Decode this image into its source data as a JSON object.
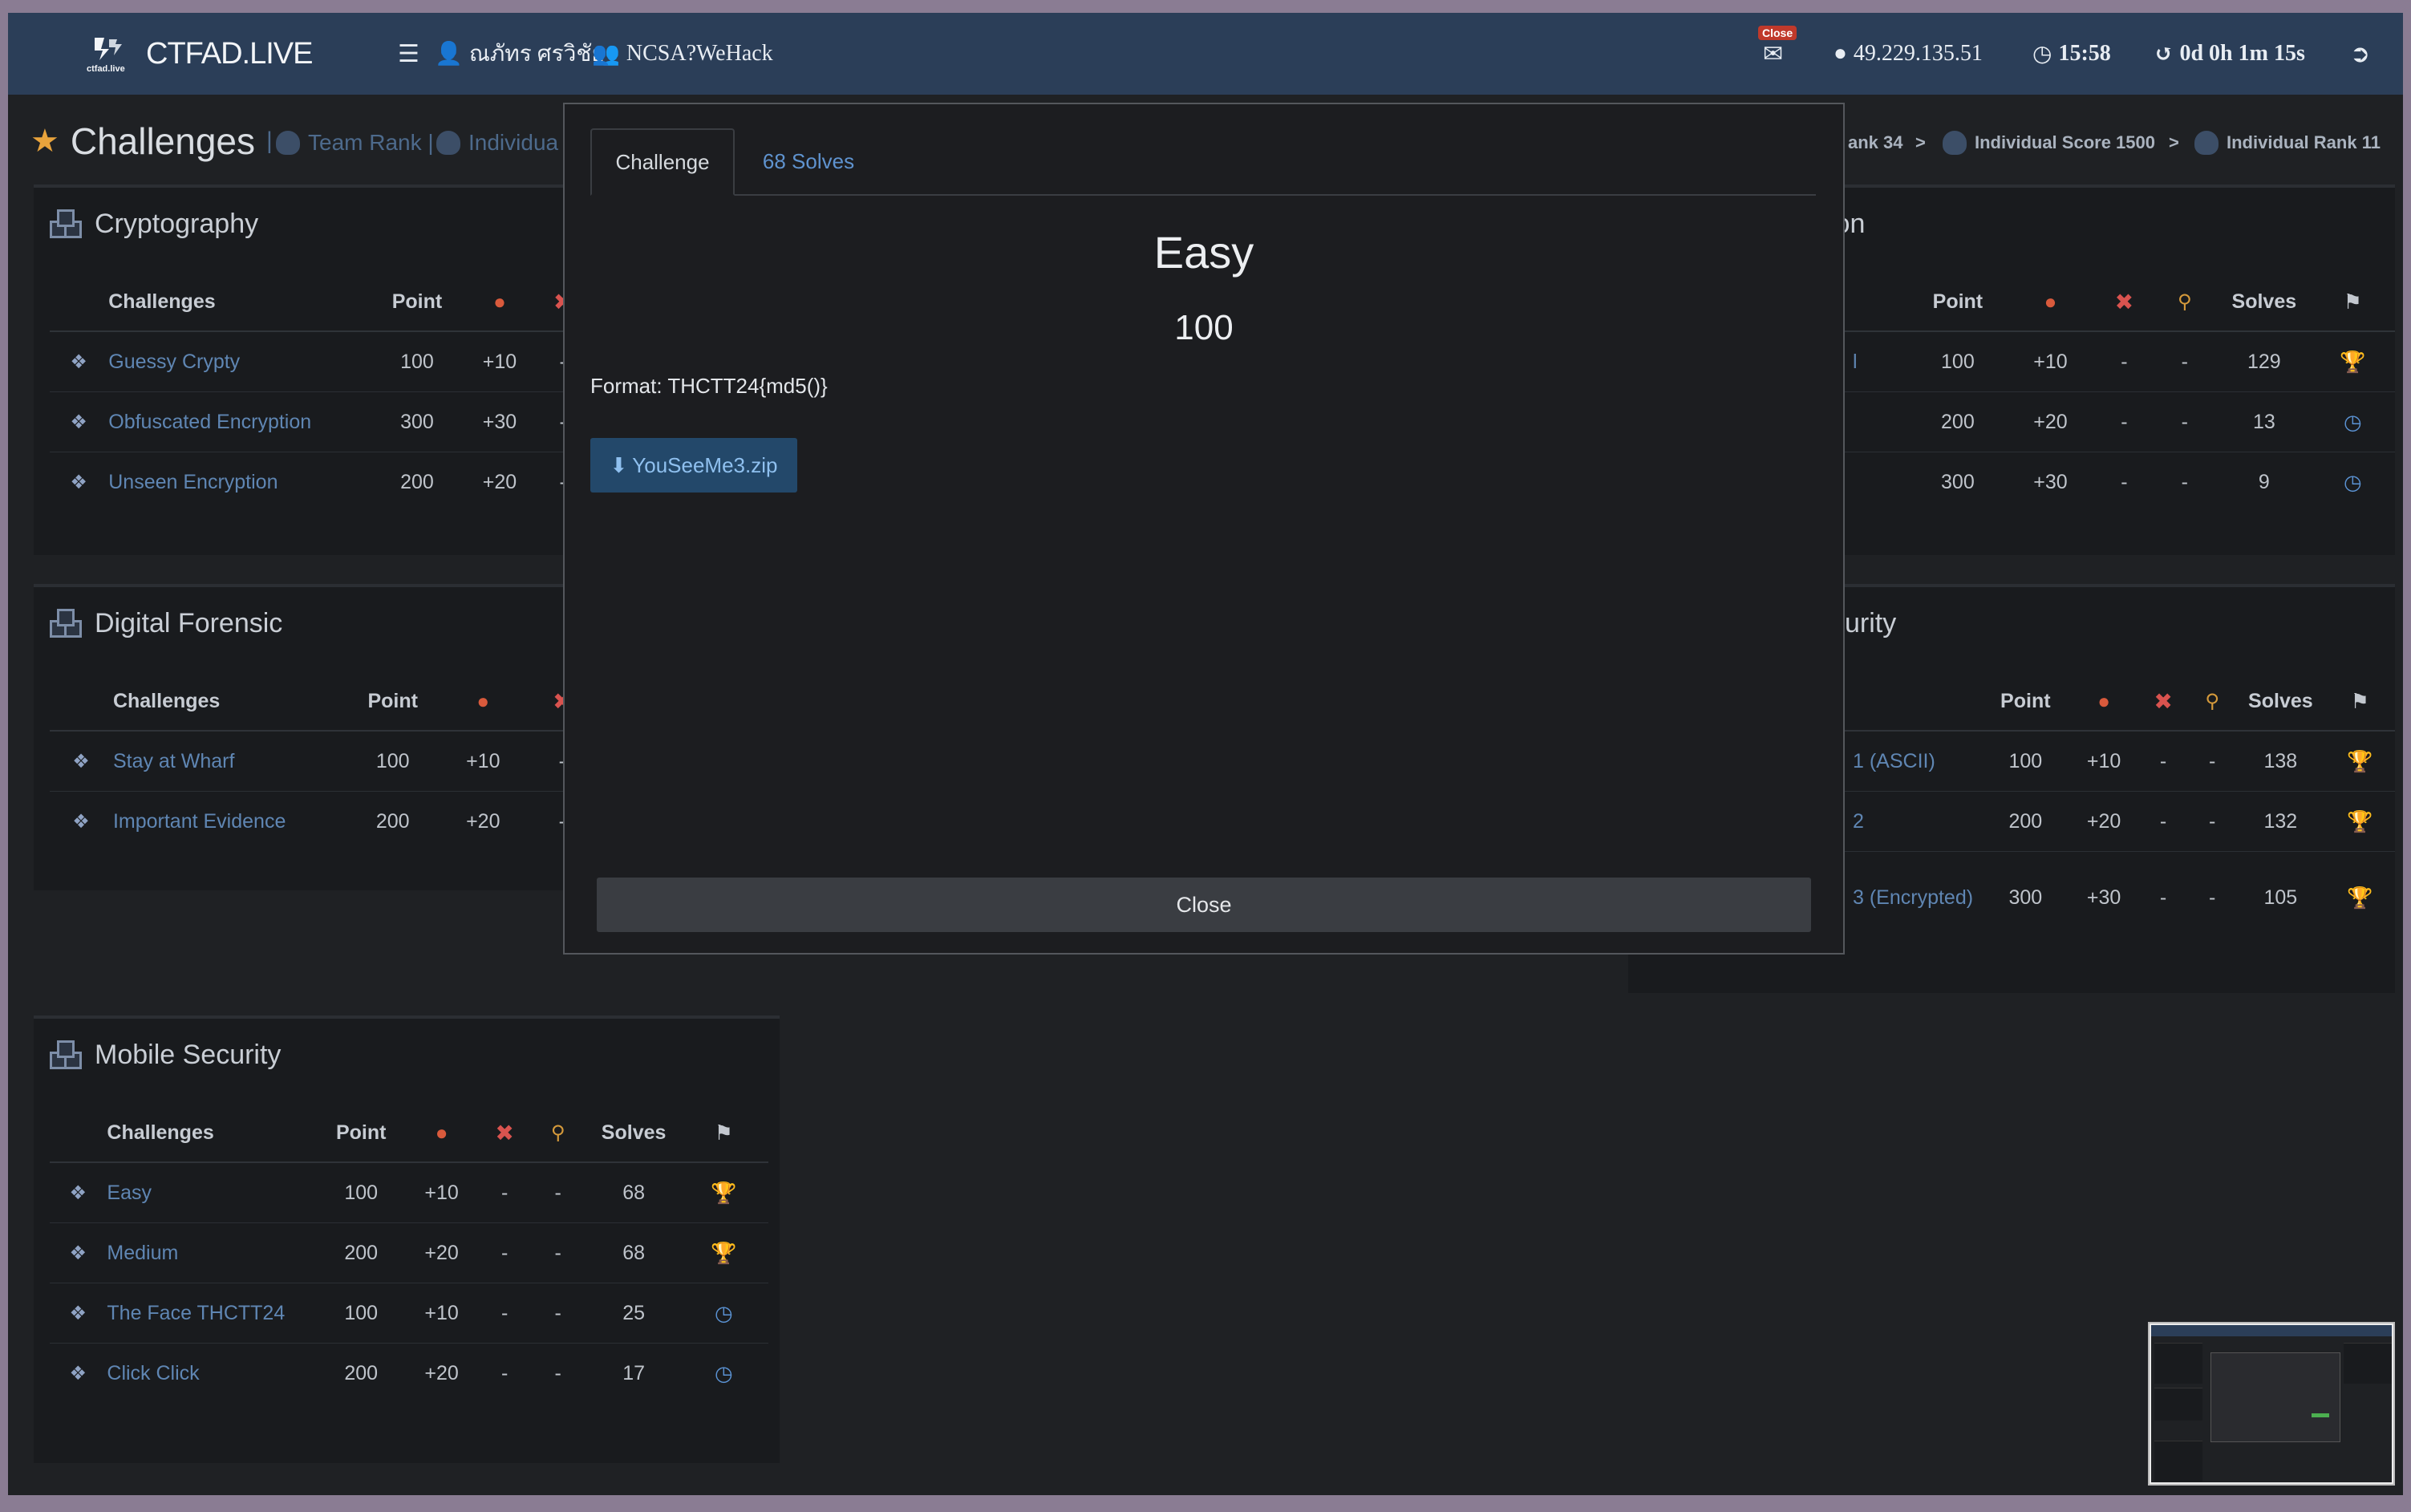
{
  "navbar": {
    "brand": "CTFAD.LIVE",
    "logo_caption": "ctfad.live",
    "user_name": "ณภัทร ศรวิชัย",
    "team_name": "NCSA?WeHack",
    "mail_badge": "Close",
    "ip": "49.229.135.51",
    "clock": "15:58",
    "elapsed": "0d 0h 1m 15s"
  },
  "header": {
    "title": "Challenges",
    "crumb_left": [
      "Team Rank |",
      "Individua"
    ],
    "crumb_right": [
      "ank 34",
      ">",
      "Individual Score 1500",
      ">",
      "Individual Rank 11"
    ]
  },
  "columns": {
    "challenges": "Challenges",
    "point": "Point",
    "solves": "Solves"
  },
  "categories": {
    "cryptography": {
      "title": "Cryptography",
      "rows": [
        {
          "name": "Guessy Crypty",
          "point": "100",
          "bonus": "+10",
          "c3": "-"
        },
        {
          "name": "Obfuscated Encryption",
          "point": "300",
          "bonus": "+30",
          "c3": "-"
        },
        {
          "name": "Unseen Encryption",
          "point": "200",
          "bonus": "+20",
          "c3": "-"
        }
      ]
    },
    "digital_forensic": {
      "title": "Digital Forensic",
      "rows": [
        {
          "name": "Stay at Wharf",
          "point": "100",
          "bonus": "+10",
          "c3": "-"
        },
        {
          "name": "Important Evidence",
          "point": "200",
          "bonus": "+20",
          "c3": "-"
        }
      ]
    },
    "right_top": {
      "title_fragment": "ion",
      "rows": [
        {
          "name": "l",
          "point": "100",
          "bonus": "+10",
          "c3": "-",
          "c4": "-",
          "solves": "129",
          "status": "trophy"
        },
        {
          "name": "",
          "point": "200",
          "bonus": "+20",
          "c3": "-",
          "c4": "-",
          "solves": "13",
          "status": "clock"
        },
        {
          "name": "",
          "point": "300",
          "bonus": "+30",
          "c3": "-",
          "c4": "-",
          "solves": "9",
          "status": "clock"
        }
      ]
    },
    "right_mid": {
      "title_fragment": "urity",
      "rows": [
        {
          "name": "1 (ASCII)",
          "point": "100",
          "bonus": "+10",
          "c3": "-",
          "c4": "-",
          "solves": "138",
          "status": "trophy"
        },
        {
          "name": "2",
          "point": "200",
          "bonus": "+20",
          "c3": "-",
          "c4": "-",
          "solves": "132",
          "status": "trophy"
        },
        {
          "name": "3 (Encrypted)",
          "point": "300",
          "bonus": "+30",
          "c3": "-",
          "c4": "-",
          "solves": "105",
          "status": "trophy"
        }
      ]
    },
    "mobile_security": {
      "title": "Mobile Security",
      "rows": [
        {
          "name": "Easy",
          "point": "100",
          "bonus": "+10",
          "c3": "-",
          "c4": "-",
          "solves": "68",
          "status": "trophy"
        },
        {
          "name": "Medium",
          "point": "200",
          "bonus": "+20",
          "c3": "-",
          "c4": "-",
          "solves": "68",
          "status": "trophy"
        },
        {
          "name": "The Face THCTT24",
          "point": "100",
          "bonus": "+10",
          "c3": "-",
          "c4": "-",
          "solves": "25",
          "status": "clock"
        },
        {
          "name": "Click Click",
          "point": "200",
          "bonus": "+20",
          "c3": "-",
          "c4": "-",
          "solves": "17",
          "status": "clock"
        }
      ]
    }
  },
  "modal": {
    "tabs": [
      "Challenge",
      "68 Solves"
    ],
    "challenge_name": "Easy",
    "points": "100",
    "description": "Format: THCTT24{md5()}",
    "download_label": "YouSeeMe3.zip",
    "close_label": "Close"
  },
  "colors": {
    "navbar": "#2b3e58",
    "background": "#1f2124",
    "link": "#5f86b3",
    "trophy": "#d4a531",
    "clock": "#5b93d4",
    "download": "#23486a"
  },
  "icons": {
    "status_trophy": "trophy-icon",
    "status_clock": "clock-icon",
    "row": "cube-icon",
    "first_blood": "drop-icon",
    "wrong": "x-icon",
    "hint": "key-icon",
    "solves": "flag-icon"
  }
}
